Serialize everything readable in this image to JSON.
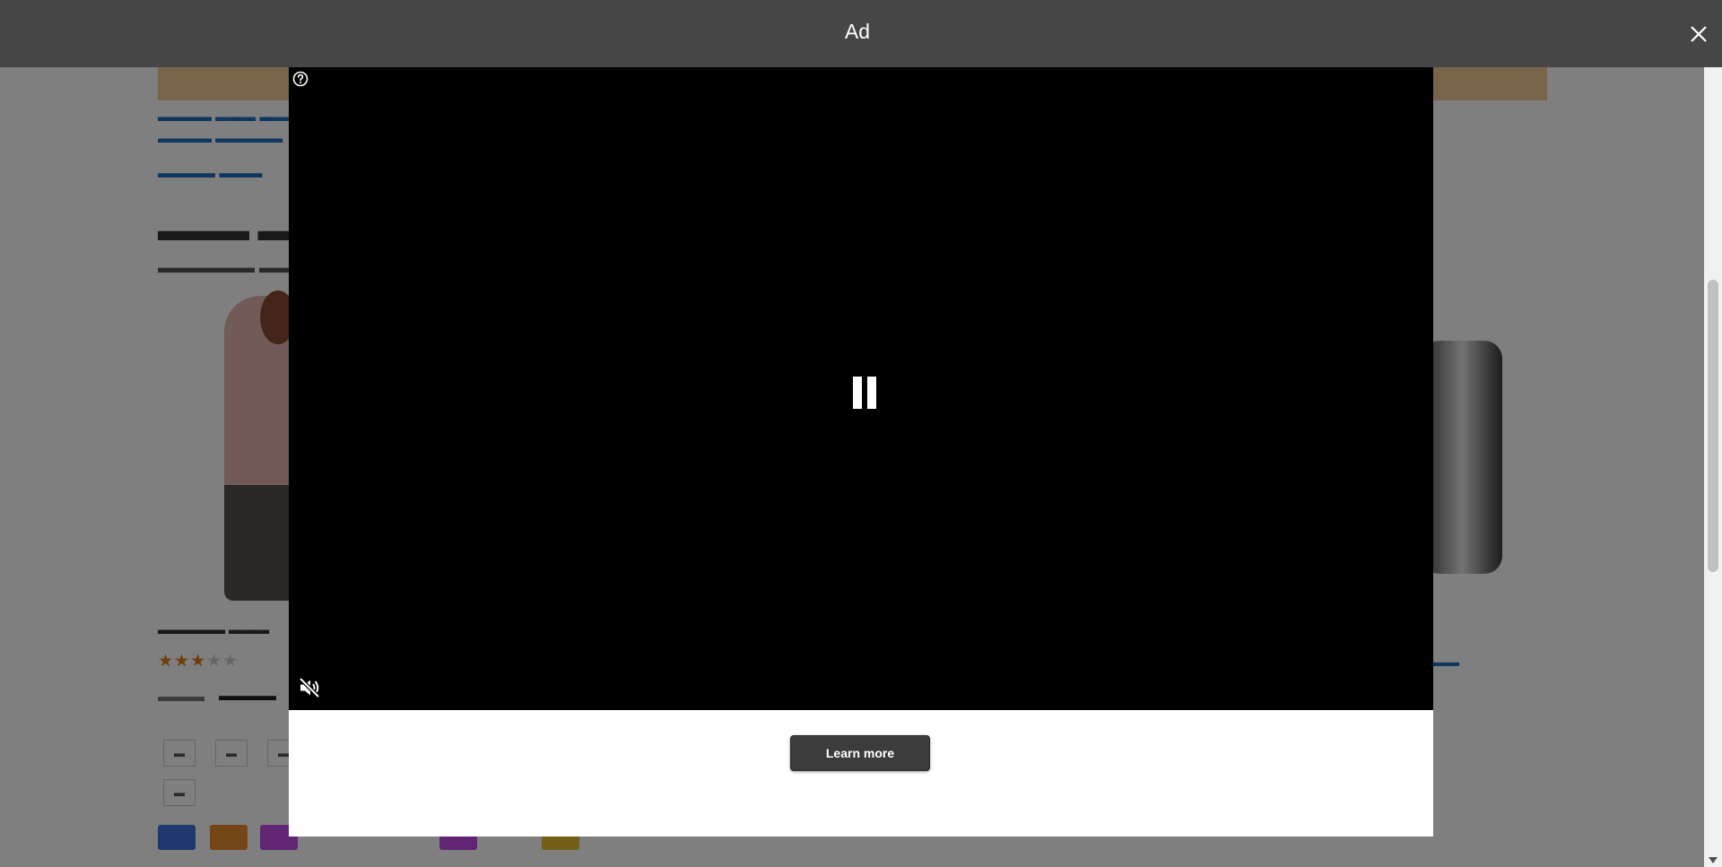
{
  "ad": {
    "title": "Ad",
    "learn_more_label": "Learn more",
    "icons": {
      "close": "close-icon",
      "help": "help-icon",
      "pause": "pause-icon",
      "mute": "muted-speaker-icon"
    },
    "colors": {
      "header_bg": "#464646",
      "video_bg": "#000000",
      "button_bg": "#3c3c3c",
      "panel_bg": "#ffffff"
    }
  },
  "background_page": {
    "star_rating": {
      "filled": 3,
      "total": 5
    },
    "swatch_colors": [
      "#3b73e0",
      "#e88a2e",
      "#c44ae6",
      "#c44ae6",
      "#e6c02e"
    ]
  }
}
